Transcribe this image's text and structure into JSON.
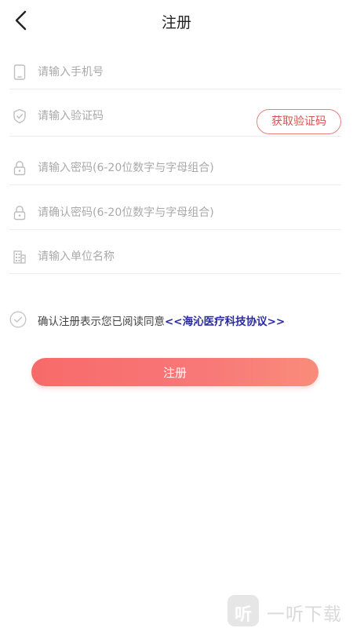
{
  "header": {
    "title": "注册",
    "back_icon": "chevron-left-icon"
  },
  "form": {
    "phone": {
      "placeholder": "请输入手机号",
      "value": "",
      "icon": "phone-icon"
    },
    "code": {
      "placeholder": "请输入验证码",
      "value": "",
      "icon": "shield-check-icon",
      "get_code_label": "获取验证码"
    },
    "password": {
      "placeholder": "请输入密码(6-20位数字与字母组合)",
      "value": "",
      "icon": "lock-icon"
    },
    "confirm_password": {
      "placeholder": "请确认密码(6-20位数字与字母组合)",
      "value": "",
      "icon": "lock-icon"
    },
    "unit": {
      "placeholder": "请输入单位名称",
      "value": "",
      "icon": "building-icon"
    }
  },
  "agreement": {
    "text": "确认注册表示您已阅读同意",
    "link": "<<海沁医疗科技协议>>",
    "check_icon": "check-circle-icon"
  },
  "submit_label": "注册",
  "watermark": {
    "badge": "听",
    "text": "一听下载"
  },
  "colors": {
    "accent": "#f86a6a",
    "link": "#2a2aa0",
    "code_border": "#e88080"
  }
}
